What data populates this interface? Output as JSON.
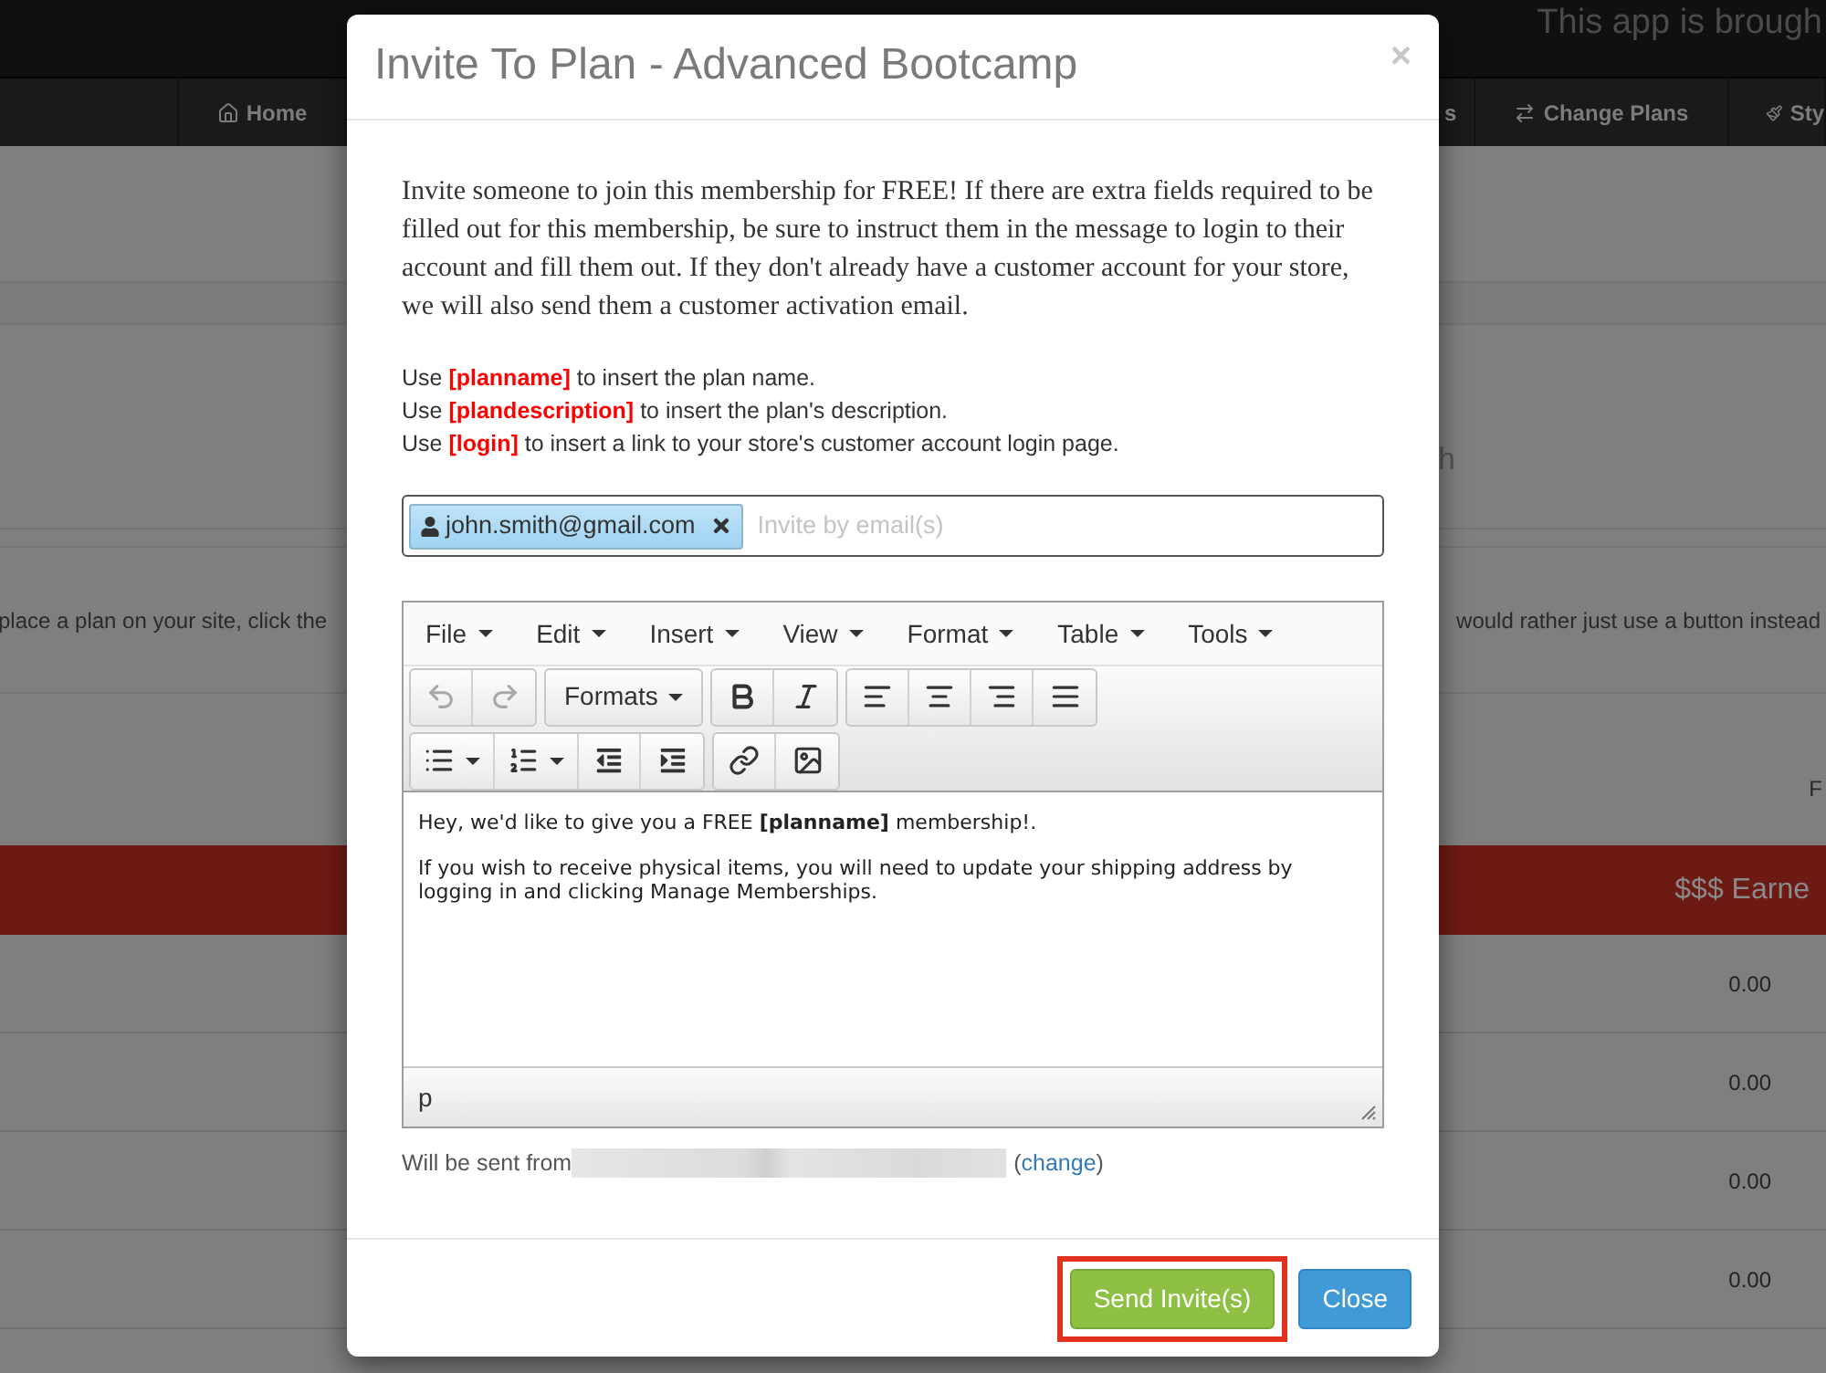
{
  "background": {
    "banner_text": "This app is brough",
    "nav": [
      {
        "label": "Home",
        "kind": "home"
      },
      {
        "label": "s",
        "kind": "plain"
      },
      {
        "label": "Change Plans",
        "kind": "change"
      },
      {
        "label": "Sty",
        "kind": "style"
      }
    ],
    "stat_text": "h",
    "notes": [
      "place a plan on your site, click the",
      "would rather just use a button instead"
    ],
    "column_label": "F",
    "table": {
      "header": "$$$ Earne",
      "rows": [
        "0.00",
        "0.00",
        "0.00",
        "0.00"
      ]
    }
  },
  "modal": {
    "title": "Invite To Plan - Advanced Bootcamp",
    "close": "×",
    "intro": "Invite someone to join this membership for FREE! If there are extra fields required to be filled out for this membership, be sure to instruct them in the message to login to their account and fill them out. If they don't already have a customer account for your store, we will also send them a customer activation email.",
    "hints": [
      "Use **[planname]** to insert the plan name.",
      "Use **[plandescription]** to insert the plan's description.",
      "Use **[login]** to insert a link to your store's customer account login page."
    ],
    "recipients": {
      "tokens": [
        {
          "label": "john.smith@gmail.com"
        }
      ],
      "placeholder": "Invite by email(s)"
    },
    "editor": {
      "menus": [
        "File",
        "Edit",
        "Insert",
        "View",
        "Format",
        "Table",
        "Tools"
      ],
      "toolbar_rows": [
        [
          [
            {
              "kind": "undo",
              "disabled": true
            },
            {
              "kind": "redo",
              "disabled": true
            }
          ],
          [
            {
              "kind": "dropdown",
              "label": "Formats"
            }
          ],
          [
            {
              "kind": "bold",
              "disabled": false
            },
            {
              "kind": "italic",
              "disabled": false
            }
          ],
          [
            {
              "kind": "align-left",
              "disabled": false
            },
            {
              "kind": "align-center",
              "disabled": false
            },
            {
              "kind": "align-right",
              "disabled": false
            },
            {
              "kind": "align-justify",
              "disabled": false
            }
          ]
        ],
        [
          [
            {
              "kind": "bullet-list",
              "disabled": false
            },
            {
              "kind": "numbered-list",
              "disabled": false
            },
            {
              "kind": "outdent",
              "disabled": false
            },
            {
              "kind": "indent",
              "disabled": false
            }
          ],
          [
            {
              "kind": "link",
              "disabled": false
            },
            {
              "kind": "image",
              "disabled": false
            }
          ]
        ]
      ],
      "paragraphs": [
        "Hey, we'd like to give you a FREE **[planname]** membership!.",
        "If you wish to receive physical items, you will need to update your shipping address by logging in and clicking Manage Memberships."
      ],
      "status_path": "p"
    },
    "sender": {
      "prefix": "Will be sent from",
      "open": "(",
      "link": "change",
      "close": ")"
    },
    "buttons": [
      {
        "label": "Send Invite(s)",
        "kind": "primary",
        "highlighted": true
      },
      {
        "label": "Close",
        "kind": "secondary",
        "highlighted": false
      }
    ]
  }
}
